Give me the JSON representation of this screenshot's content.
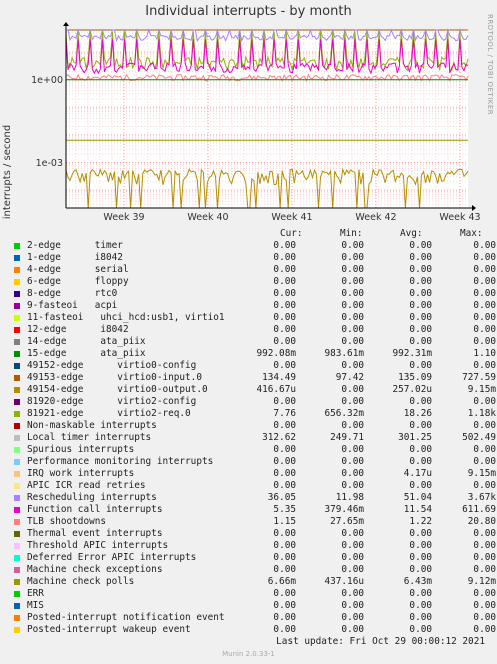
{
  "title": "Individual interrupts - by month",
  "watermark": "RRDTOOL / TOBI OETIKER",
  "footer": {
    "last_update": "Last update:  Fri Oct 29 00:00:12 2021",
    "munin": "Munin 2.0.33-1"
  },
  "chart_data": {
    "type": "line",
    "title": "Individual interrupts - by month",
    "ylabel": "interrupts / second",
    "yscale": "log",
    "y_ticks": [
      "1e+00",
      "1e-03"
    ],
    "x_ticks": [
      "Week 39",
      "Week 40",
      "Week 41",
      "Week 42",
      "Week 43"
    ],
    "grid": true,
    "legend_placement": "below",
    "columns": [
      "Cur:",
      "Min:",
      "Avg:",
      "Max:"
    ],
    "series": [
      {
        "name": "2-edge      timer",
        "color": "#00cc00",
        "cur": "0.00",
        "min": "0.00",
        "avg": "0.00",
        "max": "0.00"
      },
      {
        "name": "1-edge      i8042",
        "color": "#0066b3",
        "cur": "0.00",
        "min": "0.00",
        "avg": "0.00",
        "max": "0.00"
      },
      {
        "name": "4-edge      serial",
        "color": "#ff8000",
        "cur": "0.00",
        "min": "0.00",
        "avg": "0.00",
        "max": "0.00"
      },
      {
        "name": "6-edge      floppy",
        "color": "#ffcc00",
        "cur": "0.00",
        "min": "0.00",
        "avg": "0.00",
        "max": "0.00"
      },
      {
        "name": "8-edge      rtc0",
        "color": "#330099",
        "cur": "0.00",
        "min": "0.00",
        "avg": "0.00",
        "max": "0.00"
      },
      {
        "name": "9-fasteoi   acpi",
        "color": "#990099",
        "cur": "0.00",
        "min": "0.00",
        "avg": "0.00",
        "max": "0.00"
      },
      {
        "name": "11-fasteoi   uhci_hcd:usb1, virtio1",
        "color": "#ccff00",
        "cur": "0.00",
        "min": "0.00",
        "avg": "0.00",
        "max": "0.00"
      },
      {
        "name": "12-edge      i8042",
        "color": "#ff0000",
        "cur": "0.00",
        "min": "0.00",
        "avg": "0.00",
        "max": "0.00"
      },
      {
        "name": "14-edge      ata_piix",
        "color": "#808080",
        "cur": "0.00",
        "min": "0.00",
        "avg": "0.00",
        "max": "0.00"
      },
      {
        "name": "15-edge      ata_piix",
        "color": "#008f00",
        "cur": "992.08m",
        "min": "983.61m",
        "avg": "992.31m",
        "max": "1.10"
      },
      {
        "name": "49152-edge      virtio0-config",
        "color": "#00487d",
        "cur": "0.00",
        "min": "0.00",
        "avg": "0.00",
        "max": "0.00"
      },
      {
        "name": "49153-edge      virtio0-input.0",
        "color": "#b35a00",
        "cur": "134.49",
        "min": "97.42",
        "avg": "135.09",
        "max": "727.59"
      },
      {
        "name": "49154-edge      virtio0-output.0",
        "color": "#b38f00",
        "cur": "416.67u",
        "min": "0.00",
        "avg": "257.02u",
        "max": "9.15m"
      },
      {
        "name": "81920-edge      virtio2-config",
        "color": "#6b006b",
        "cur": "0.00",
        "min": "0.00",
        "avg": "0.00",
        "max": "0.00"
      },
      {
        "name": "81921-edge      virtio2-req.0",
        "color": "#8fb300",
        "cur": "7.76",
        "min": "656.32m",
        "avg": "18.26",
        "max": "1.18k"
      },
      {
        "name": "Non-maskable interrupts",
        "color": "#b30000",
        "cur": "0.00",
        "min": "0.00",
        "avg": "0.00",
        "max": "0.00"
      },
      {
        "name": "Local timer interrupts",
        "color": "#bebebe",
        "cur": "312.62",
        "min": "249.71",
        "avg": "301.25",
        "max": "502.49"
      },
      {
        "name": "Spurious interrupts",
        "color": "#80ff80",
        "cur": "0.00",
        "min": "0.00",
        "avg": "0.00",
        "max": "0.00"
      },
      {
        "name": "Performance monitoring interrupts",
        "color": "#80c9ff",
        "cur": "0.00",
        "min": "0.00",
        "avg": "0.00",
        "max": "0.00"
      },
      {
        "name": "IRQ work interrupts",
        "color": "#ffc080",
        "cur": "0.00",
        "min": "0.00",
        "avg": "4.17u",
        "max": "9.15m"
      },
      {
        "name": "APIC ICR read retries",
        "color": "#ffe680",
        "cur": "0.00",
        "min": "0.00",
        "avg": "0.00",
        "max": "0.00"
      },
      {
        "name": "Rescheduling interrupts",
        "color": "#aa80ff",
        "cur": "36.05",
        "min": "11.98",
        "avg": "51.04",
        "max": "3.67k"
      },
      {
        "name": "Function call interrupts",
        "color": "#ee00cc",
        "cur": "5.35",
        "min": "379.46m",
        "avg": "11.54",
        "max": "611.69"
      },
      {
        "name": "TLB shootdowns",
        "color": "#ff8080",
        "cur": "1.15",
        "min": "27.65m",
        "avg": "1.22",
        "max": "20.80"
      },
      {
        "name": "Thermal event interrupts",
        "color": "#666600",
        "cur": "0.00",
        "min": "0.00",
        "avg": "0.00",
        "max": "0.00"
      },
      {
        "name": "Threshold APIC interrupts",
        "color": "#ffbfff",
        "cur": "0.00",
        "min": "0.00",
        "avg": "0.00",
        "max": "0.00"
      },
      {
        "name": "Deferred Error APIC interrupts",
        "color": "#00ffcc",
        "cur": "0.00",
        "min": "0.00",
        "avg": "0.00",
        "max": "0.00"
      },
      {
        "name": "Machine check exceptions",
        "color": "#cc6699",
        "cur": "0.00",
        "min": "0.00",
        "avg": "0.00",
        "max": "0.00"
      },
      {
        "name": "Machine check polls",
        "color": "#999900",
        "cur": "6.66m",
        "min": "437.16u",
        "avg": "6.43m",
        "max": "9.12m"
      },
      {
        "name": "ERR",
        "color": "#00cc00",
        "cur": "0.00",
        "min": "0.00",
        "avg": "0.00",
        "max": "0.00"
      },
      {
        "name": "MIS",
        "color": "#0066b3",
        "cur": "0.00",
        "min": "0.00",
        "avg": "0.00",
        "max": "0.00"
      },
      {
        "name": "Posted-interrupt notification event",
        "color": "#ff8000",
        "cur": "0.00",
        "min": "0.00",
        "avg": "0.00",
        "max": "0.00"
      },
      {
        "name": "Posted-interrupt wakeup event",
        "color": "#ffcc00",
        "cur": "0.00",
        "min": "0.00",
        "avg": "0.00",
        "max": "0.00"
      }
    ]
  }
}
